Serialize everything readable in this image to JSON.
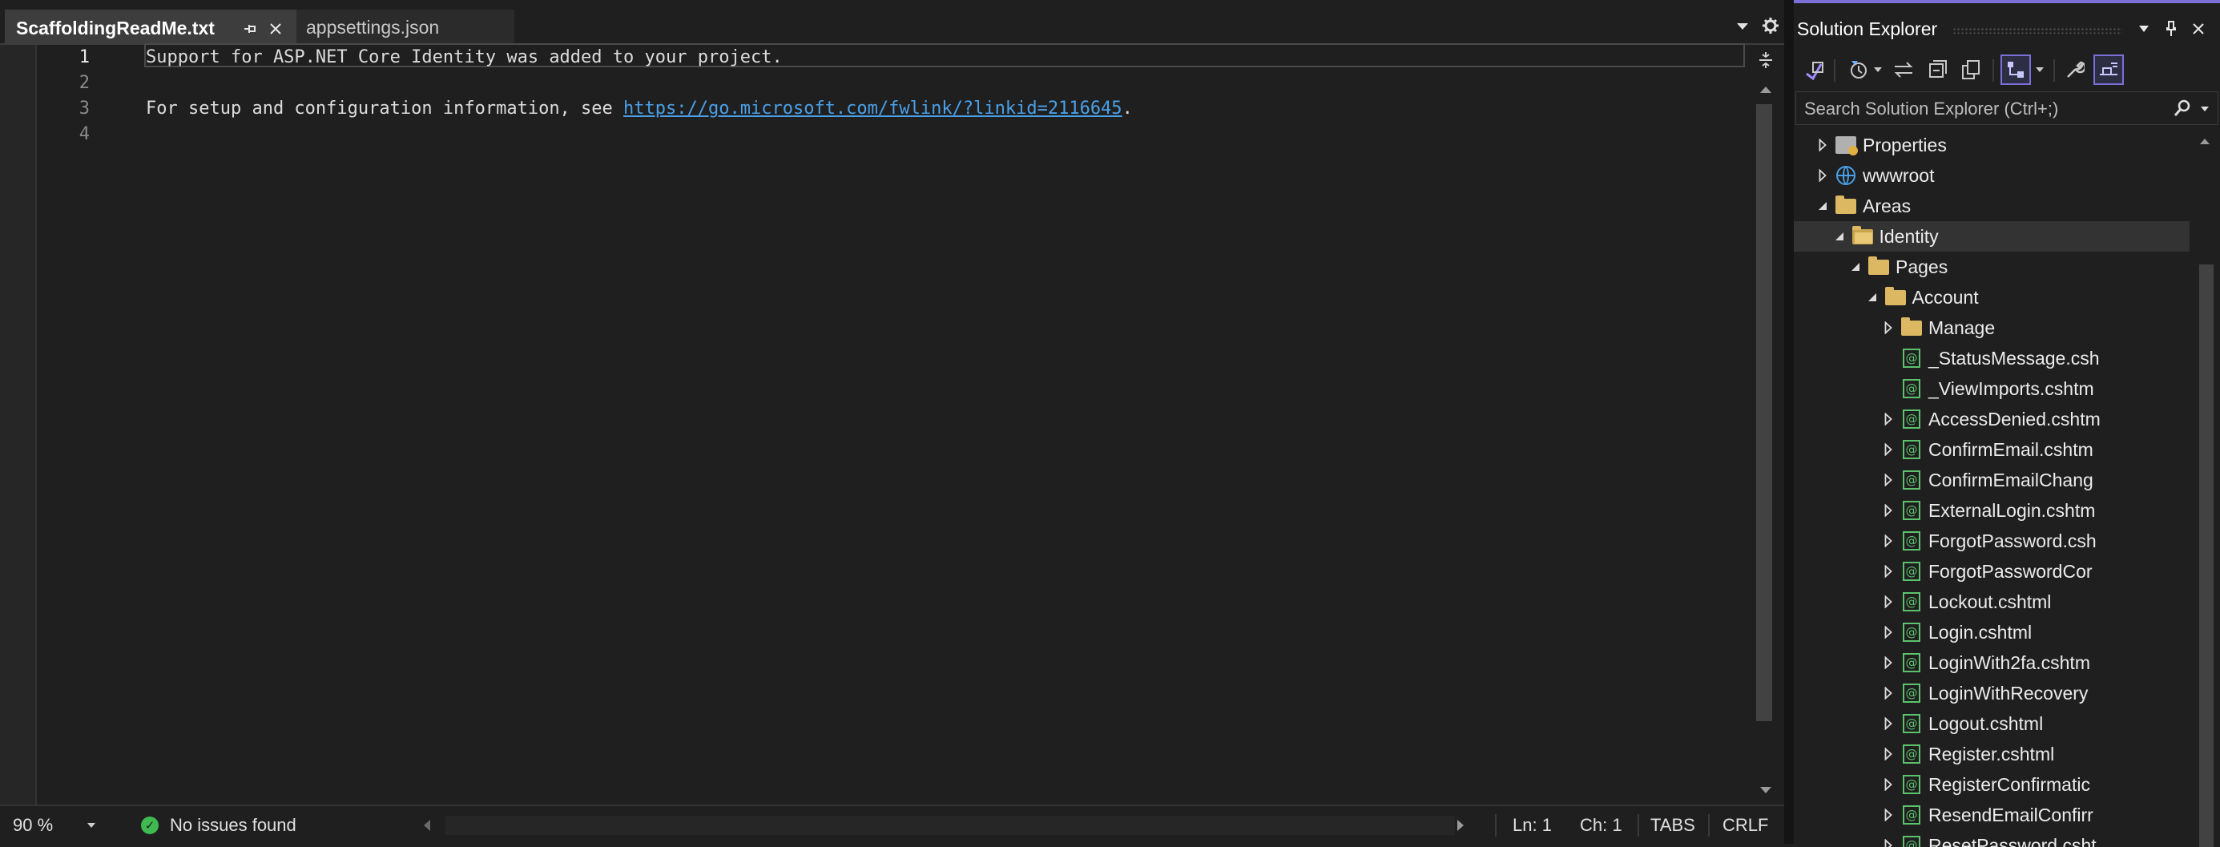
{
  "editor": {
    "tabs": [
      {
        "label": "ScaffoldingReadMe.txt",
        "active": true
      },
      {
        "label": "appsettings.json",
        "active": false
      }
    ],
    "pin_icon": "pin-icon",
    "close_icon": "close-icon",
    "lines": [
      {
        "num": "1",
        "text": "Support for ASP.NET Core Identity was added to your project."
      },
      {
        "num": "2",
        "text": ""
      },
      {
        "num": "3",
        "text": "For setup and configuration information, see ",
        "link": "https://go.microsoft.com/fwlink/?linkid=2116645",
        "after": "."
      },
      {
        "num": "4",
        "text": ""
      }
    ],
    "colors": {
      "link": "#4aa0e8",
      "background": "#1f1f1f"
    }
  },
  "status": {
    "zoom": "90 %",
    "issues": "No issues found",
    "ln": "Ln: 1",
    "ch": "Ch: 1",
    "tabs_mode": "TABS",
    "eol": "CRLF"
  },
  "solution_explorer": {
    "title": "Solution Explorer",
    "search_placeholder": "Search Solution Explorer (Ctrl+;)",
    "accent": "#7b6fd8",
    "tree": [
      {
        "label": "Properties",
        "icon": "properties-icon",
        "level": 1,
        "expander": "collapsed"
      },
      {
        "label": "wwwroot",
        "icon": "globe-icon",
        "level": 1,
        "expander": "collapsed"
      },
      {
        "label": "Areas",
        "icon": "folder-icon",
        "level": 1,
        "expander": "expanded"
      },
      {
        "label": "Identity",
        "icon": "folder-open-icon",
        "level": 2,
        "expander": "expanded",
        "selected": true
      },
      {
        "label": "Pages",
        "icon": "folder-icon",
        "level": 3,
        "expander": "expanded"
      },
      {
        "label": "Account",
        "icon": "folder-icon",
        "level": 4,
        "expander": "expanded"
      },
      {
        "label": "Manage",
        "icon": "folder-icon",
        "level": 5,
        "expander": "collapsed"
      },
      {
        "label": "_StatusMessage.csh",
        "icon": "razor-file-icon",
        "level": 5,
        "expander": "none"
      },
      {
        "label": "_ViewImports.cshtm",
        "icon": "razor-file-icon",
        "level": 5,
        "expander": "none"
      },
      {
        "label": "AccessDenied.cshtm",
        "icon": "razor-file-icon",
        "level": 5,
        "expander": "collapsed"
      },
      {
        "label": "ConfirmEmail.cshtm",
        "icon": "razor-file-icon",
        "level": 5,
        "expander": "collapsed"
      },
      {
        "label": "ConfirmEmailChang",
        "icon": "razor-file-icon",
        "level": 5,
        "expander": "collapsed"
      },
      {
        "label": "ExternalLogin.cshtm",
        "icon": "razor-file-icon",
        "level": 5,
        "expander": "collapsed"
      },
      {
        "label": "ForgotPassword.csh",
        "icon": "razor-file-icon",
        "level": 5,
        "expander": "collapsed"
      },
      {
        "label": "ForgotPasswordCor",
        "icon": "razor-file-icon",
        "level": 5,
        "expander": "collapsed"
      },
      {
        "label": "Lockout.cshtml",
        "icon": "razor-file-icon",
        "level": 5,
        "expander": "collapsed"
      },
      {
        "label": "Login.cshtml",
        "icon": "razor-file-icon",
        "level": 5,
        "expander": "collapsed"
      },
      {
        "label": "LoginWith2fa.cshtm",
        "icon": "razor-file-icon",
        "level": 5,
        "expander": "collapsed"
      },
      {
        "label": "LoginWithRecovery",
        "icon": "razor-file-icon",
        "level": 5,
        "expander": "collapsed"
      },
      {
        "label": "Logout.cshtml",
        "icon": "razor-file-icon",
        "level": 5,
        "expander": "collapsed"
      },
      {
        "label": "Register.cshtml",
        "icon": "razor-file-icon",
        "level": 5,
        "expander": "collapsed"
      },
      {
        "label": "RegisterConfirmatic",
        "icon": "razor-file-icon",
        "level": 5,
        "expander": "collapsed"
      },
      {
        "label": "ResendEmailConfirr",
        "icon": "razor-file-icon",
        "level": 5,
        "expander": "collapsed"
      },
      {
        "label": "ResetPassword.csht",
        "icon": "razor-file-icon",
        "level": 5,
        "expander": "collapsed"
      }
    ]
  }
}
